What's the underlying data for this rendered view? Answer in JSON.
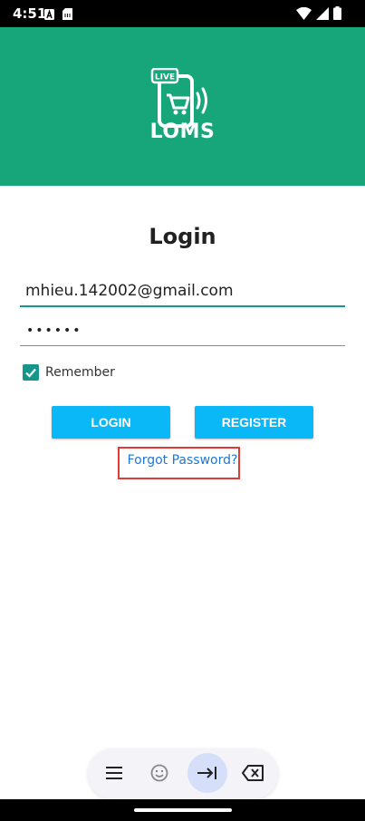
{
  "status_bar": {
    "time": "4:51"
  },
  "header": {
    "logo_badge": "LIVE",
    "logo_text": "LOMS",
    "background_color": "#16A67A"
  },
  "login": {
    "title": "Login",
    "email_value": "mhieu.142002@gmail.com",
    "password_value": "••••••",
    "remember_label": "Remember",
    "remember_checked": true,
    "login_button": "LOGIN",
    "register_button": "REGISTER",
    "forgot_link": "Forgot Password?",
    "button_color": "#0AB7F7",
    "accent_color": "#16968A"
  },
  "keyboard_toolbar": {
    "icons": [
      "menu-icon",
      "emoji-icon",
      "tab-icon",
      "backspace-icon"
    ]
  }
}
